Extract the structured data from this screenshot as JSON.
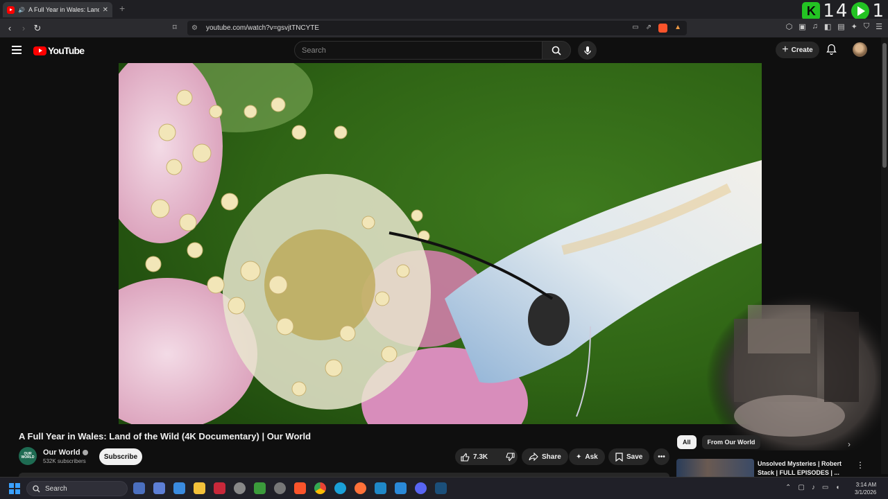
{
  "browser": {
    "tab_title": "A Full Year in Wales: Land of the Wild",
    "url": "youtube.com/watch?v=gsvjtTNCYTE",
    "overlay_count_1": "14",
    "overlay_count_2": "1"
  },
  "youtube": {
    "logo_text": "YouTube",
    "search_placeholder": "Search",
    "create_label": "Create"
  },
  "video": {
    "title": "A Full Year in Wales: Land of the Wild (4K Documentary) | Our World",
    "channel_name": "Our World",
    "channel_avatar_text": "OUR WORLD",
    "subscribers": "532K subscribers",
    "subscribe_label": "Subscribe",
    "likes": "7.3K",
    "share_label": "Share",
    "ask_label": "Ask",
    "save_label": "Save"
  },
  "sidebar": {
    "chips": [
      "All",
      "From Our World"
    ],
    "recommendation": {
      "title": "Unsolved Mysteries | Robert Stack | FULL EPISODES | ..."
    }
  },
  "taskbar": {
    "search_label": "Search",
    "time": "3:14 AM",
    "date": "3/1/2026"
  },
  "colors": {
    "youtube_red": "#ff0000",
    "background": "#0f0f0f",
    "overlay_green": "#23c323"
  }
}
